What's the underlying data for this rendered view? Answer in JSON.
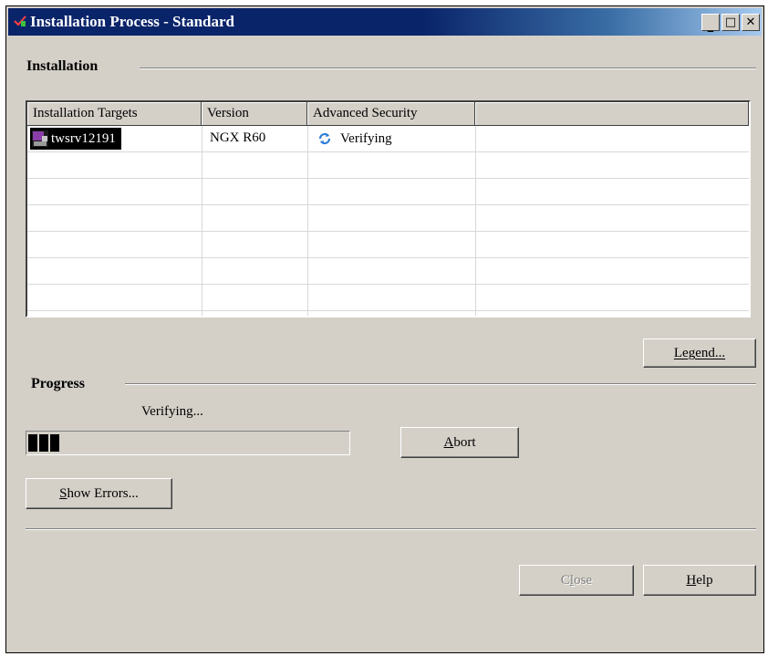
{
  "window": {
    "title": "Installation Process  - Standard",
    "controls": [
      "minimize",
      "maximize",
      "close"
    ]
  },
  "installation": {
    "section_label": "Installation",
    "columns": [
      "Installation Targets",
      "Version",
      "Advanced Security",
      ""
    ],
    "rows": [
      {
        "target": "twsrv12191",
        "version": "NGX R60",
        "security_status": "Verifying",
        "target_icon": "gateway-icon",
        "status_icon": "refresh-icon"
      }
    ],
    "legend_button": "Legend..."
  },
  "progress": {
    "section_label": "Progress",
    "status_text": "Verifying...",
    "fraction": 0.1,
    "abort_button": "Abort",
    "show_errors_button": "Show Errors..."
  },
  "footer": {
    "close_button": "Close",
    "help_button": "Help"
  },
  "colors": {
    "title_bar": "#0a246a",
    "dialog_face": "#d4d0c8",
    "status_icon": "#2c7fd6"
  }
}
